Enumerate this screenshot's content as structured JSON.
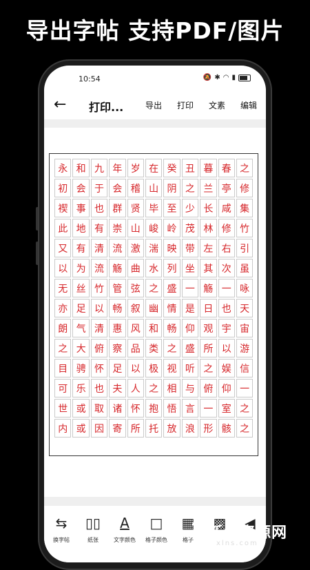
{
  "banner": {
    "text": "导出字帖 支持PDF/图片"
  },
  "status": {
    "time": "10:54"
  },
  "toolbar": {
    "title": "打印...",
    "export": "导出",
    "print": "打印",
    "text": "文素",
    "edit": "编辑"
  },
  "sheet": {
    "rows": [
      [
        "永",
        "和",
        "九",
        "年",
        "岁",
        "在",
        "癸",
        "丑",
        "暮",
        "春",
        "之"
      ],
      [
        "初",
        "会",
        "于",
        "会",
        "稽",
        "山",
        "阴",
        "之",
        "兰",
        "亭",
        "修"
      ],
      [
        "禊",
        "事",
        "也",
        "群",
        "贤",
        "毕",
        "至",
        "少",
        "长",
        "咸",
        "集"
      ],
      [
        "此",
        "地",
        "有",
        "崇",
        "山",
        "峻",
        "岭",
        "茂",
        "林",
        "修",
        "竹"
      ],
      [
        "又",
        "有",
        "清",
        "流",
        "激",
        "湍",
        "映",
        "带",
        "左",
        "右",
        "引"
      ],
      [
        "以",
        "为",
        "流",
        "觞",
        "曲",
        "水",
        "列",
        "坐",
        "其",
        "次",
        "虽"
      ],
      [
        "无",
        "丝",
        "竹",
        "管",
        "弦",
        "之",
        "盛",
        "一",
        "觞",
        "一",
        "咏"
      ],
      [
        "亦",
        "足",
        "以",
        "畅",
        "叙",
        "幽",
        "情",
        "是",
        "日",
        "也",
        "天"
      ],
      [
        "朗",
        "气",
        "清",
        "惠",
        "风",
        "和",
        "畅",
        "仰",
        "观",
        "宇",
        "宙"
      ],
      [
        "之",
        "大",
        "俯",
        "察",
        "品",
        "类",
        "之",
        "盛",
        "所",
        "以",
        "游"
      ],
      [
        "目",
        "骋",
        "怀",
        "足",
        "以",
        "极",
        "视",
        "听",
        "之",
        "娱",
        "信"
      ],
      [
        "可",
        "乐",
        "也",
        "夫",
        "人",
        "之",
        "相",
        "与",
        "俯",
        "仰",
        "一"
      ],
      [
        "世",
        "或",
        "取",
        "诸",
        "怀",
        "抱",
        "悟",
        "言",
        "一",
        "室",
        "之"
      ],
      [
        "内",
        "或",
        "因",
        "寄",
        "所",
        "托",
        "放",
        "浪",
        "形",
        "骸",
        "之"
      ]
    ],
    "char_color": "#d6262a"
  },
  "bottom": {
    "items": [
      {
        "icon": "swap-icon",
        "label": "换字帖"
      },
      {
        "icon": "layout-icon",
        "label": "纸张"
      },
      {
        "icon": "text-color-icon",
        "label": "文字颜色"
      },
      {
        "icon": "grid-color-icon",
        "label": "格子颜色"
      },
      {
        "icon": "grid-style-icon",
        "label": "格子"
      },
      {
        "icon": "grid-type-icon",
        "label": ""
      },
      {
        "icon": "more-icon",
        "label": ""
      }
    ]
  },
  "watermark": {
    "logo": "Z",
    "text": "新绿资源网",
    "sub": "xlns.com"
  }
}
